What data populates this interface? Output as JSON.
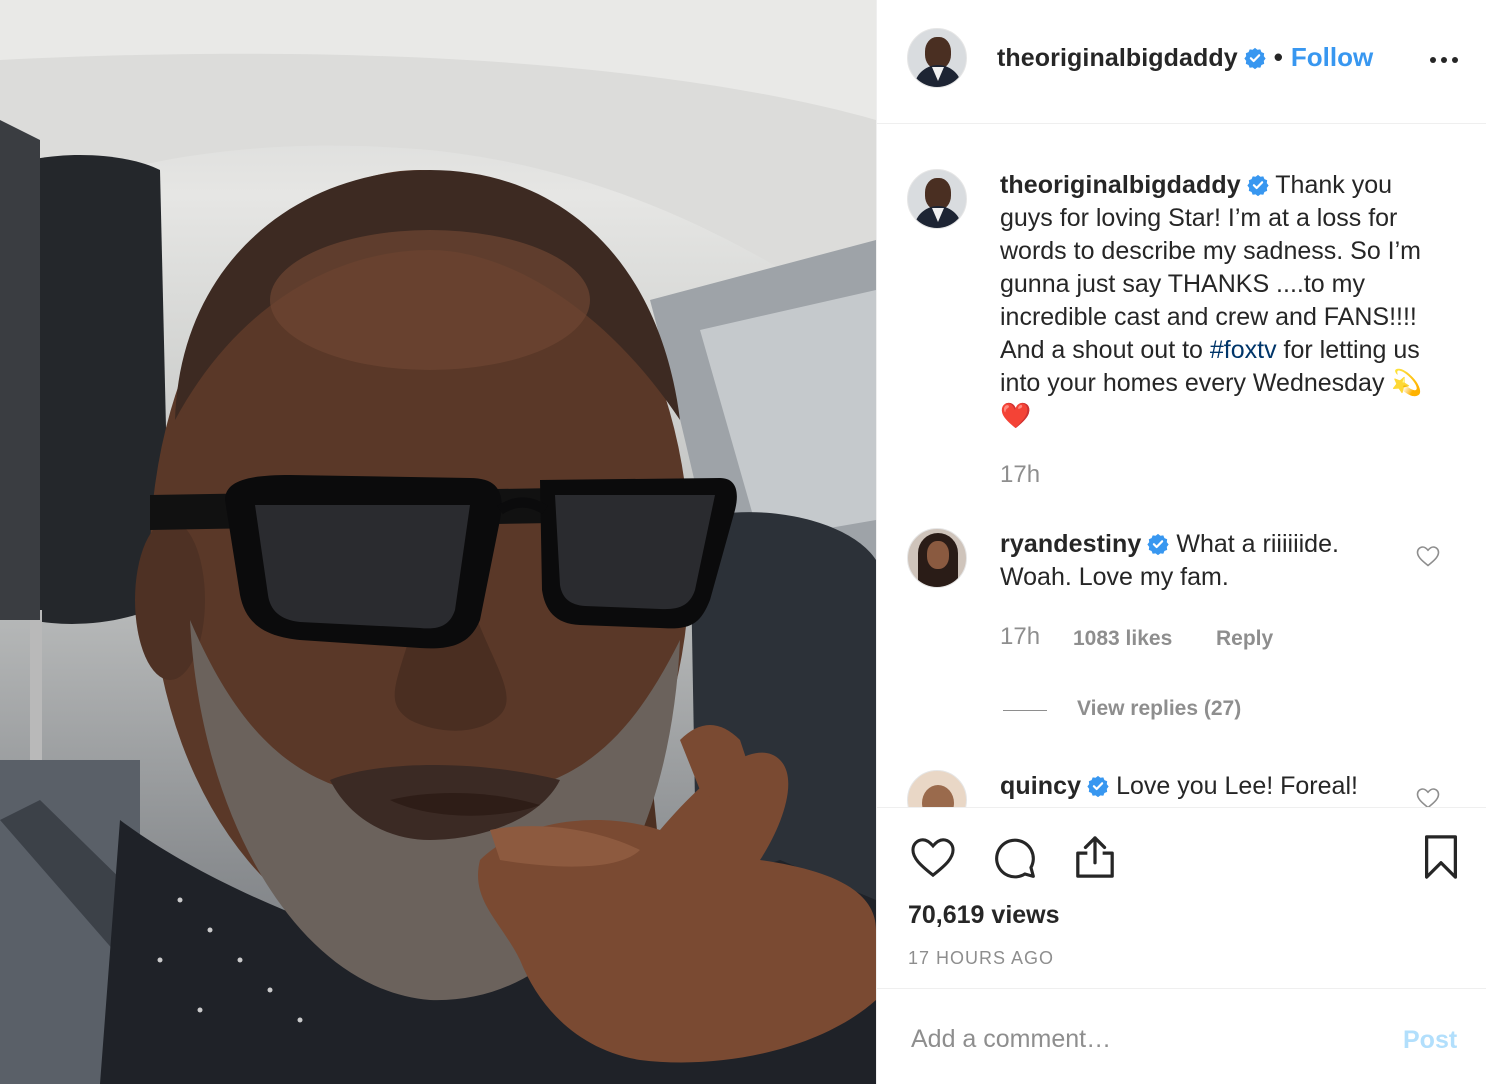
{
  "colors": {
    "link_blue": "#3897f0",
    "hashtag_blue": "#003569",
    "text_primary": "#262626",
    "text_secondary": "#8e8e8e",
    "post_disabled": "#b2dffc",
    "verified_badge": "#3897f0"
  },
  "media": {
    "description_icon": "video-frame"
  },
  "header": {
    "username": "theoriginalbigdaddy",
    "separator": "•",
    "follow_label": "Follow",
    "more_icon": "more-horizontal-icon"
  },
  "caption": {
    "username": "theoriginalbigdaddy",
    "text_before_tag": " Thank you guys for loving Star! I’m at a loss for words to describe my sadness. So I’m gunna just say THANKS ....to my incredible cast and crew and FANS!!!! And a shout out to ",
    "hashtag": "#foxtv",
    "text_after_tag": " for letting us into your homes every Wednesday ",
    "emojis": "💫❤️",
    "time": "17h"
  },
  "comments": [
    {
      "username": "ryandestiny",
      "text": " What a riiiiiide. Woah. Love my fam.",
      "time": "17h",
      "likes": "1083 likes",
      "reply_label": "Reply",
      "view_replies": "View replies (27)"
    },
    {
      "username": "quincy",
      "text": " Love you Lee! Foreal!"
    }
  ],
  "actions": {
    "like_icon": "heart-icon",
    "comment_icon": "comment-icon",
    "share_icon": "share-icon",
    "save_icon": "bookmark-icon",
    "views": "70,619 views",
    "posted": "17 HOURS AGO"
  },
  "add_comment": {
    "placeholder": "Add a comment…",
    "post_label": "Post"
  }
}
